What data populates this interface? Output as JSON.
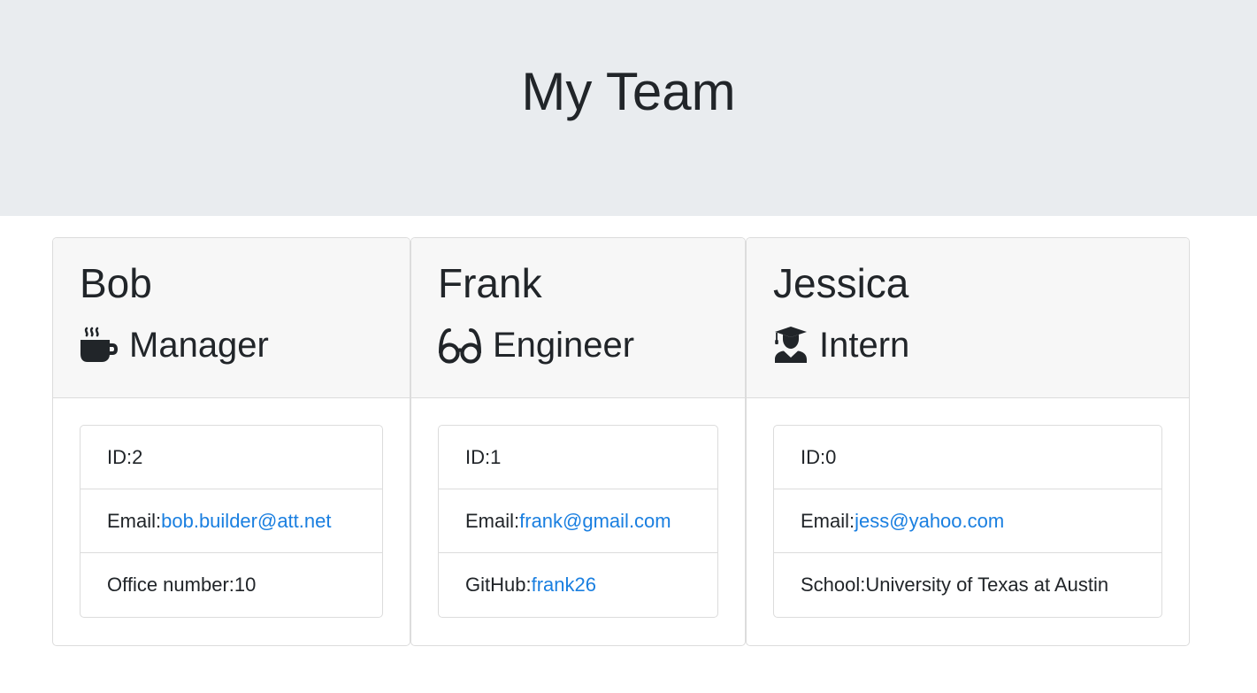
{
  "header": {
    "title": "My Team"
  },
  "colors": {
    "jumbotron_bg": "#e9ecef",
    "link": "#1a7fe0",
    "text": "#212529"
  },
  "employees": [
    {
      "name": "Bob",
      "role": "Manager",
      "icon": "coffee-icon",
      "id_label": "ID: ",
      "id": "2",
      "email_label": "Email: ",
      "email": "bob.builder@att.net",
      "extra_label": "Office number: ",
      "extra_value": "10"
    },
    {
      "name": "Frank",
      "role": "Engineer",
      "icon": "glasses-icon",
      "id_label": "ID: ",
      "id": "1",
      "email_label": "Email: ",
      "email": "frank@gmail.com",
      "extra_label": "GitHub: ",
      "extra_value": "frank26"
    },
    {
      "name": "Jessica",
      "role": "Intern",
      "icon": "graduate-icon",
      "id_label": "ID: ",
      "id": "0",
      "email_label": "Email: ",
      "email": "jess@yahoo.com",
      "extra_label": "School: ",
      "extra_value": "University of Texas at Austin"
    }
  ]
}
